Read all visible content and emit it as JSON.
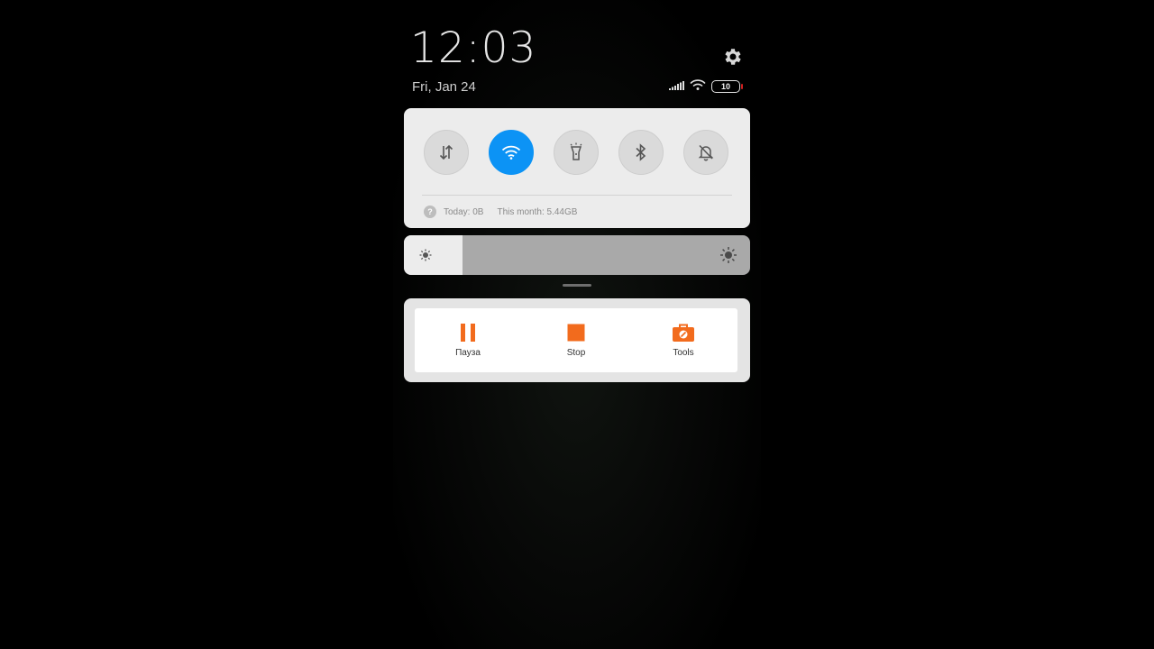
{
  "status_bar": {
    "time": "12:03",
    "date": "Fri, Jan 24",
    "battery_level": "10",
    "settings_icon": "gear-icon",
    "signal_icon": "cellular-signal-icon",
    "wifi_icon": "wifi-icon"
  },
  "quick_settings": {
    "toggles": [
      {
        "name": "Mobile data",
        "icon": "data-arrows-icon",
        "active": false
      },
      {
        "name": "Wi-Fi",
        "icon": "wifi-icon",
        "active": true
      },
      {
        "name": "Flashlight",
        "icon": "flashlight-icon",
        "active": false
      },
      {
        "name": "Bluetooth",
        "icon": "bluetooth-icon",
        "active": false
      },
      {
        "name": "Silent",
        "icon": "bell-off-icon",
        "active": false
      }
    ],
    "usage_today": "Today: 0B",
    "usage_month": "This month: 5.44GB"
  },
  "brightness": {
    "level": 0.17
  },
  "notification": {
    "buttons": [
      {
        "label": "Пауза",
        "icon": "pause-icon"
      },
      {
        "label": "Stop",
        "icon": "stop-icon"
      },
      {
        "label": "Tools",
        "icon": "toolbox-icon"
      }
    ]
  },
  "colors": {
    "accent": "#0c93f5",
    "orange": "#f26b1d",
    "panel": "#ececec"
  }
}
